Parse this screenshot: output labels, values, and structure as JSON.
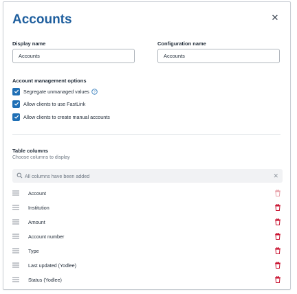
{
  "dialog": {
    "title": "Accounts",
    "close_icon": "close-icon"
  },
  "form": {
    "display_name": {
      "label": "Display name",
      "value": "Accounts"
    },
    "configuration_name": {
      "label": "Configuration name",
      "value": "Accounts"
    }
  },
  "options": {
    "title": "Account management options",
    "items": [
      {
        "label": "Segregate unmanaged values",
        "checked": true,
        "help_icon": "help-circle-icon"
      },
      {
        "label": "Allow clients to use FastLink",
        "checked": true
      },
      {
        "label": "Allow clients to create manual accounts",
        "checked": true
      }
    ]
  },
  "table_columns": {
    "title": "Table columns",
    "subtitle": "Choose columns to display",
    "search": {
      "placeholder": "All columns have been added",
      "icon": "search-icon",
      "clear_icon": "clear-icon"
    },
    "columns": [
      {
        "label": "Account",
        "delete_enabled": false
      },
      {
        "label": "Institution",
        "delete_enabled": true
      },
      {
        "label": "Amount",
        "delete_enabled": true
      },
      {
        "label": "Account number",
        "delete_enabled": true
      },
      {
        "label": "Type",
        "delete_enabled": true
      },
      {
        "label": "Last updated (Yodlee)",
        "delete_enabled": true
      },
      {
        "label": "Status (Yodlee)",
        "delete_enabled": true
      }
    ]
  },
  "colors": {
    "accent": "#1f6fb5",
    "title": "#1f5f9e",
    "delete": "#c8102e",
    "delete_disabled": "#e8a0a8"
  }
}
